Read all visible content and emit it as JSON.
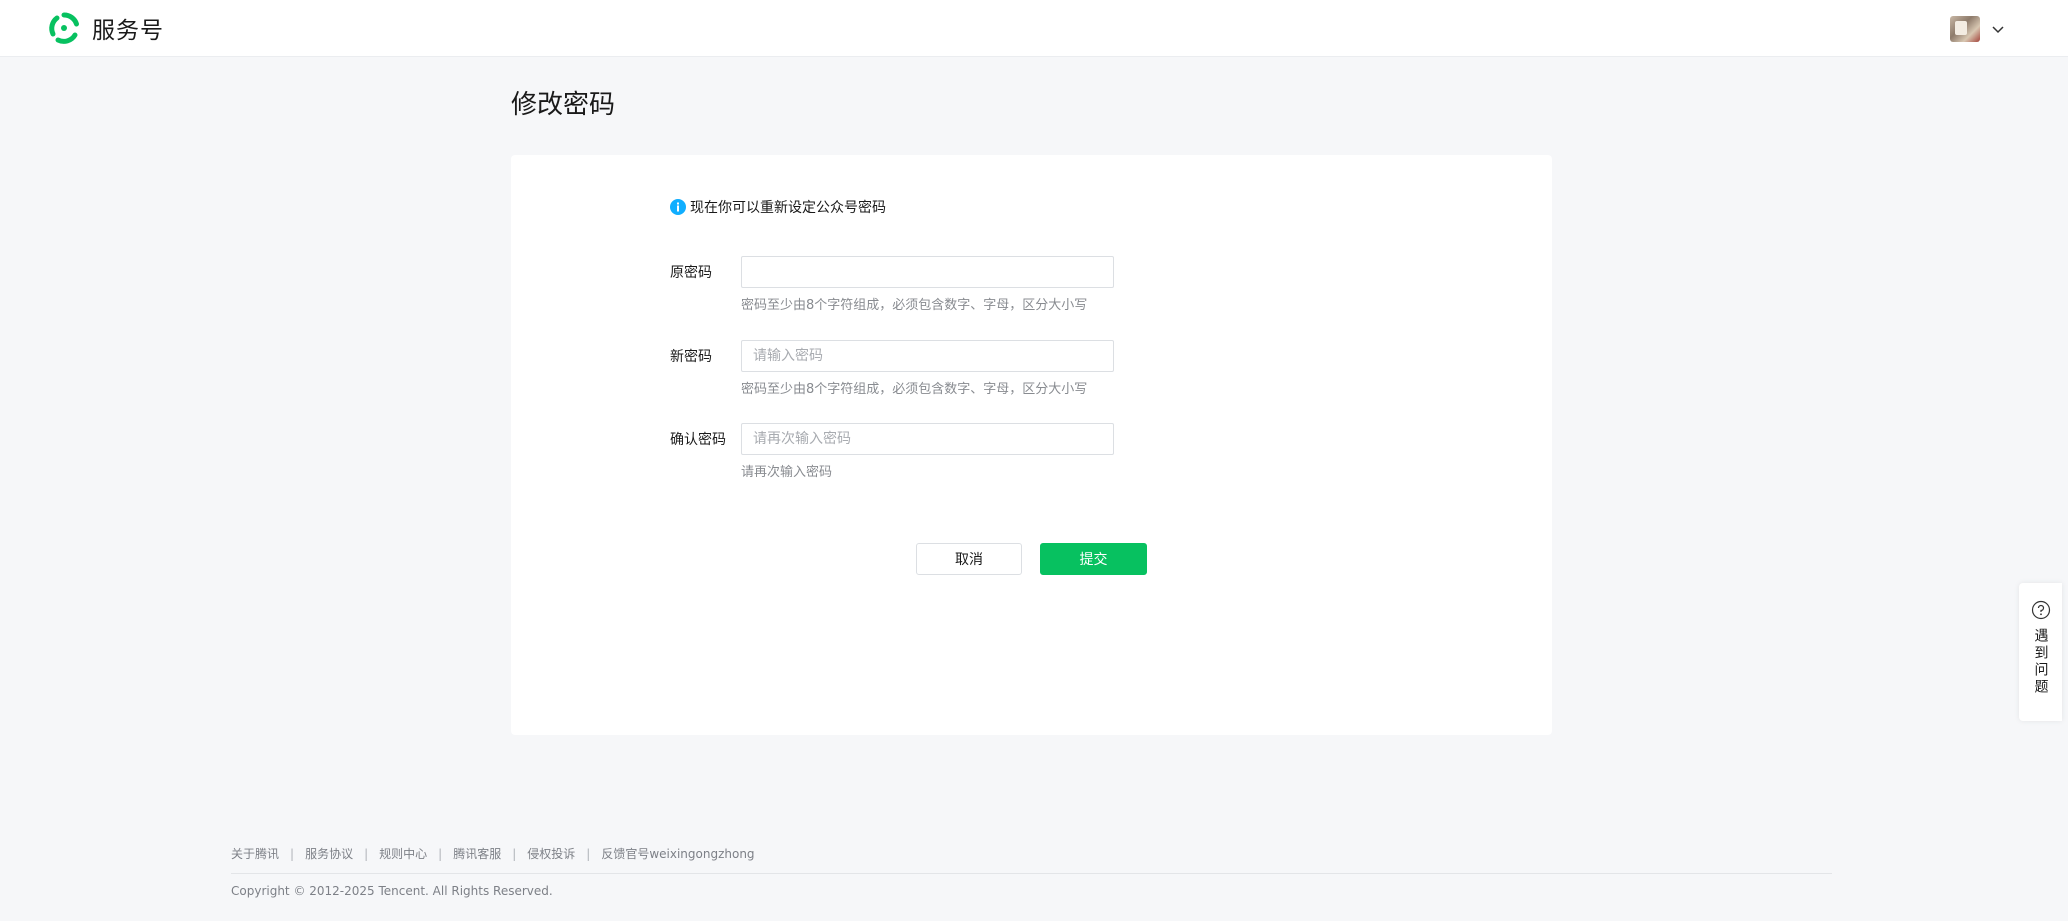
{
  "header": {
    "brand_name": "服务号",
    "logo_icon": "service-account-logo-icon",
    "account_menu_icon": "chevron-down-icon"
  },
  "page": {
    "title": "修改密码"
  },
  "form": {
    "notice": "现在你可以重新设定公众号密码",
    "notice_icon": "info-icon",
    "fields": [
      {
        "label": "原密码",
        "value": "",
        "placeholder": "",
        "hint": "密码至少由8个字符组成，必须包含数字、字母，区分大小写"
      },
      {
        "label": "新密码",
        "value": "",
        "placeholder": "请输入密码",
        "hint": "密码至少由8个字符组成，必须包含数字、字母，区分大小写"
      },
      {
        "label": "确认密码",
        "value": "",
        "placeholder": "请再次输入密码",
        "hint": "请再次输入密码"
      }
    ],
    "cancel_label": "取消",
    "submit_label": "提交"
  },
  "help": {
    "label": "遇到问题",
    "icon": "question-circle-icon"
  },
  "footer": {
    "links": [
      "关于腾讯",
      "服务协议",
      "规则中心",
      "腾讯客服",
      "侵权投诉",
      "反馈官号weixingongzhong"
    ],
    "separator": "|",
    "copyright": "Copyright © 2012-2025 Tencent. All Rights Reserved."
  },
  "colors": {
    "accent": "#07c160",
    "info": "#10aeff",
    "page_background": "#f6f7f9"
  }
}
